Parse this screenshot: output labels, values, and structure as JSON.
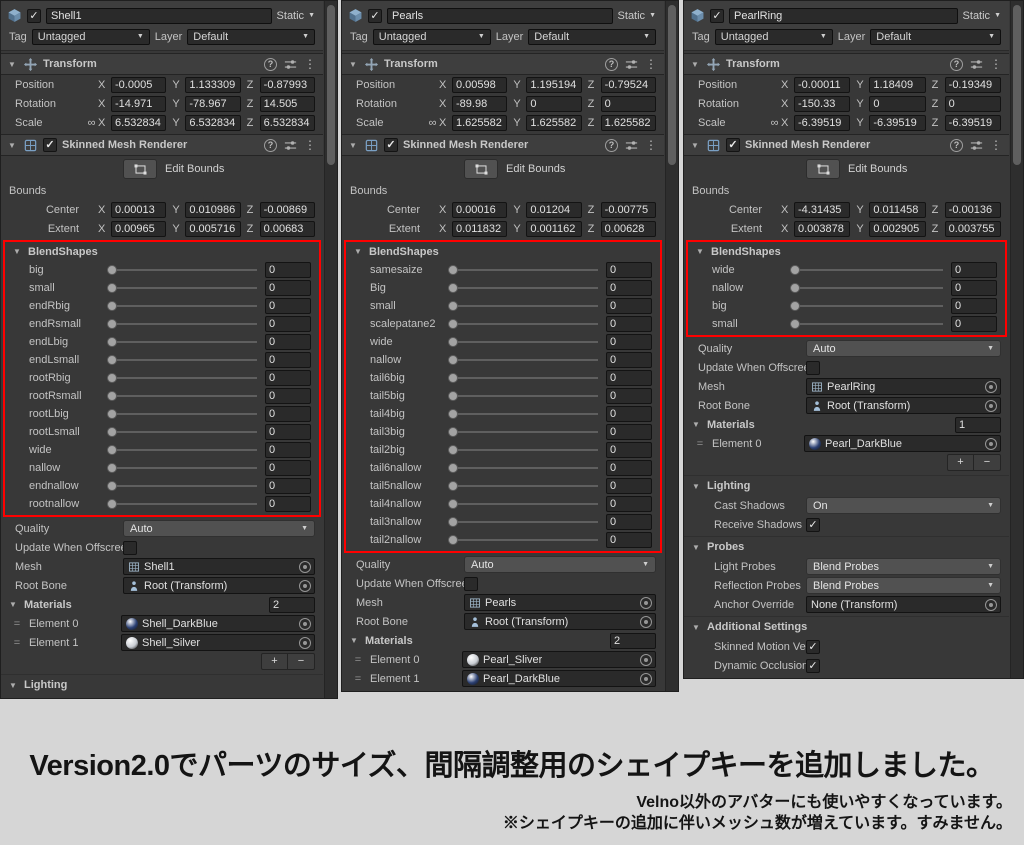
{
  "axes": {
    "x": "X",
    "y": "Y",
    "z": "Z"
  },
  "icons": {
    "chevron_down": "▼",
    "foldout": "▼",
    "check": "✓",
    "kebab": "⋮",
    "help": "?",
    "link": "∞",
    "drag_handle": "="
  },
  "colors": {
    "highlight_red": "#ff0000",
    "panel_background": "#383838",
    "material_dark_blue": "#2a3f72",
    "material_silver": "#c9cdd3"
  },
  "banner": {
    "title": "Version2.0でパーツのサイズ、間隔調整用のシェイプキーを追加しました。",
    "subtitle1": "Velno以外のアバターにも使いやすくなっています。",
    "subtitle2": "※シェイプキーの追加に伴いメッシュ数が増えています。すみません。"
  },
  "panels": [
    {
      "header": {
        "name": "Shell1",
        "static_label": "Static",
        "enabled": true
      },
      "tag": {
        "label": "Tag",
        "value": "Untagged"
      },
      "layer": {
        "label": "Layer",
        "value": "Default"
      },
      "transform": {
        "title": "Transform",
        "rows": [
          {
            "label": "Position",
            "x": "-0.0005",
            "y": "1.133309",
            "z": "-0.87993"
          },
          {
            "label": "Rotation",
            "x": "-14.971",
            "y": "-78.967",
            "z": "14.505"
          },
          {
            "label": "Scale",
            "x": "6.532834",
            "y": "6.532834",
            "z": "6.532834",
            "linked": true
          }
        ]
      },
      "renderer": {
        "title": "Skinned Mesh Renderer",
        "enabled": true,
        "edit_bounds_label": "Edit Bounds",
        "bounds_label": "Bounds",
        "bounds_rows": [
          {
            "label": "Center",
            "x": "0.00013",
            "y": "0.010986",
            "z": "-0.00869"
          },
          {
            "label": "Extent",
            "x": "0.00965",
            "y": "0.005716",
            "z": "0.00683"
          }
        ],
        "blendshapes": {
          "title": "BlendShapes",
          "items": [
            {
              "label": "big",
              "value": "0"
            },
            {
              "label": "small",
              "value": "0"
            },
            {
              "label": "endRbig",
              "value": "0"
            },
            {
              "label": "endRsmall",
              "value": "0"
            },
            {
              "label": "endLbig",
              "value": "0"
            },
            {
              "label": "endLsmall",
              "value": "0"
            },
            {
              "label": "rootRbig",
              "value": "0"
            },
            {
              "label": "rootRsmall",
              "value": "0"
            },
            {
              "label": "rootLbig",
              "value": "0"
            },
            {
              "label": "rootLsmall",
              "value": "0"
            },
            {
              "label": "wide",
              "value": "0"
            },
            {
              "label": "nallow",
              "value": "0"
            },
            {
              "label": "endnallow",
              "value": "0"
            },
            {
              "label": "rootnallow",
              "value": "0"
            }
          ]
        },
        "quality": {
          "label": "Quality",
          "value": "Auto"
        },
        "update_when_offscreen": {
          "label": "Update When Offscreen",
          "checked": false
        },
        "mesh": {
          "label": "Mesh",
          "value": "Shell1"
        },
        "root_bone": {
          "label": "Root Bone",
          "value": "Root (Transform)"
        },
        "materials": {
          "title": "Materials",
          "count": "2",
          "elements": [
            {
              "label": "Element 0",
              "value": "Shell_DarkBlue",
              "color": "#2a3f72"
            },
            {
              "label": "Element 1",
              "value": "Shell_Silver",
              "color": "#c9cdd3"
            }
          ],
          "show_buttons": true,
          "add_label": "+",
          "remove_label": "−"
        },
        "extra_sections": [
          {
            "title": "Lighting",
            "rows": []
          }
        ]
      }
    },
    {
      "header": {
        "name": "Pearls",
        "static_label": "Static",
        "enabled": true
      },
      "tag": {
        "label": "Tag",
        "value": "Untagged"
      },
      "layer": {
        "label": "Layer",
        "value": "Default"
      },
      "transform": {
        "title": "Transform",
        "rows": [
          {
            "label": "Position",
            "x": "0.00598",
            "y": "1.195194",
            "z": "-0.79524"
          },
          {
            "label": "Rotation",
            "x": "-89.98",
            "y": "0",
            "z": "0"
          },
          {
            "label": "Scale",
            "x": "1.625582",
            "y": "1.625582",
            "z": "1.625582",
            "linked": true
          }
        ]
      },
      "renderer": {
        "title": "Skinned Mesh Renderer",
        "enabled": true,
        "edit_bounds_label": "Edit Bounds",
        "bounds_label": "Bounds",
        "bounds_rows": [
          {
            "label": "Center",
            "x": "0.00016",
            "y": "0.01204",
            "z": "-0.00775"
          },
          {
            "label": "Extent",
            "x": "0.011832",
            "y": "0.001162",
            "z": "0.00628"
          }
        ],
        "blendshapes": {
          "title": "BlendShapes",
          "items": [
            {
              "label": "samesaize",
              "value": "0"
            },
            {
              "label": "Big",
              "value": "0"
            },
            {
              "label": "small",
              "value": "0"
            },
            {
              "label": "scalepatane2",
              "value": "0"
            },
            {
              "label": "wide",
              "value": "0"
            },
            {
              "label": "nallow",
              "value": "0"
            },
            {
              "label": "tail6big",
              "value": "0"
            },
            {
              "label": "tail5big",
              "value": "0"
            },
            {
              "label": "tail4big",
              "value": "0"
            },
            {
              "label": "tail3big",
              "value": "0"
            },
            {
              "label": "tail2big",
              "value": "0"
            },
            {
              "label": "tail6nallow",
              "value": "0"
            },
            {
              "label": "tail5nallow",
              "value": "0"
            },
            {
              "label": "tail4nallow",
              "value": "0"
            },
            {
              "label": "tail3nallow",
              "value": "0"
            },
            {
              "label": "tail2nallow",
              "value": "0"
            }
          ]
        },
        "quality": {
          "label": "Quality",
          "value": "Auto"
        },
        "update_when_offscreen": {
          "label": "Update When Offscreen",
          "checked": false
        },
        "mesh": {
          "label": "Mesh",
          "value": "Pearls"
        },
        "root_bone": {
          "label": "Root Bone",
          "value": "Root (Transform)"
        },
        "materials": {
          "title": "Materials",
          "count": "2",
          "elements": [
            {
              "label": "Element 0",
              "value": "Pearl_Sliver",
              "color": "#c9cdd3"
            },
            {
              "label": "Element 1",
              "value": "Pearl_DarkBlue",
              "color": "#2a3f72"
            }
          ],
          "show_buttons": false,
          "add_label": "+",
          "remove_label": "−"
        },
        "extra_sections": []
      }
    },
    {
      "header": {
        "name": "PearlRing",
        "static_label": "Static",
        "enabled": true
      },
      "tag": {
        "label": "Tag",
        "value": "Untagged"
      },
      "layer": {
        "label": "Layer",
        "value": "Default"
      },
      "transform": {
        "title": "Transform",
        "rows": [
          {
            "label": "Position",
            "x": "-0.00011",
            "y": "1.18409",
            "z": "-0.19349"
          },
          {
            "label": "Rotation",
            "x": "-150.33",
            "y": "0",
            "z": "0"
          },
          {
            "label": "Scale",
            "x": "-6.39519",
            "y": "-6.39519",
            "z": "-6.39519",
            "linked": true
          }
        ]
      },
      "renderer": {
        "title": "Skinned Mesh Renderer",
        "enabled": true,
        "edit_bounds_label": "Edit Bounds",
        "bounds_label": "Bounds",
        "bounds_rows": [
          {
            "label": "Center",
            "x": "-4.31435",
            "y": "0.011458",
            "z": "-0.00136"
          },
          {
            "label": "Extent",
            "x": "0.003878",
            "y": "0.002905",
            "z": "0.003755"
          }
        ],
        "blendshapes": {
          "title": "BlendShapes",
          "items": [
            {
              "label": "wide",
              "value": "0"
            },
            {
              "label": "nallow",
              "value": "0"
            },
            {
              "label": "big",
              "value": "0"
            },
            {
              "label": "small",
              "value": "0"
            }
          ]
        },
        "quality": {
          "label": "Quality",
          "value": "Auto"
        },
        "update_when_offscreen": {
          "label": "Update When Offscreen",
          "checked": false
        },
        "mesh": {
          "label": "Mesh",
          "value": "PearlRing"
        },
        "root_bone": {
          "label": "Root Bone",
          "value": "Root (Transform)"
        },
        "materials": {
          "title": "Materials",
          "count": "1",
          "elements": [
            {
              "label": "Element 0",
              "value": "Pearl_DarkBlue",
              "color": "#2a3f72"
            }
          ],
          "show_buttons": true,
          "add_label": "+",
          "remove_label": "−"
        },
        "extra_sections": [
          {
            "title": "Lighting",
            "rows": [
              {
                "label": "Cast Shadows",
                "type": "dropdown",
                "value": "On"
              },
              {
                "label": "Receive Shadows",
                "type": "check",
                "checked": true
              }
            ]
          },
          {
            "title": "Probes",
            "rows": [
              {
                "label": "Light Probes",
                "type": "dropdown",
                "value": "Blend Probes"
              },
              {
                "label": "Reflection Probes",
                "type": "dropdown",
                "value": "Blend Probes"
              },
              {
                "label": "Anchor Override",
                "type": "object",
                "value": "None (Transform)"
              }
            ]
          },
          {
            "title": "Additional Settings",
            "rows": [
              {
                "label": "Skinned Motion Vectors",
                "type": "check",
                "checked": true
              },
              {
                "label": "Dynamic Occlusion",
                "type": "check",
                "checked": true
              }
            ]
          }
        ]
      }
    }
  ]
}
